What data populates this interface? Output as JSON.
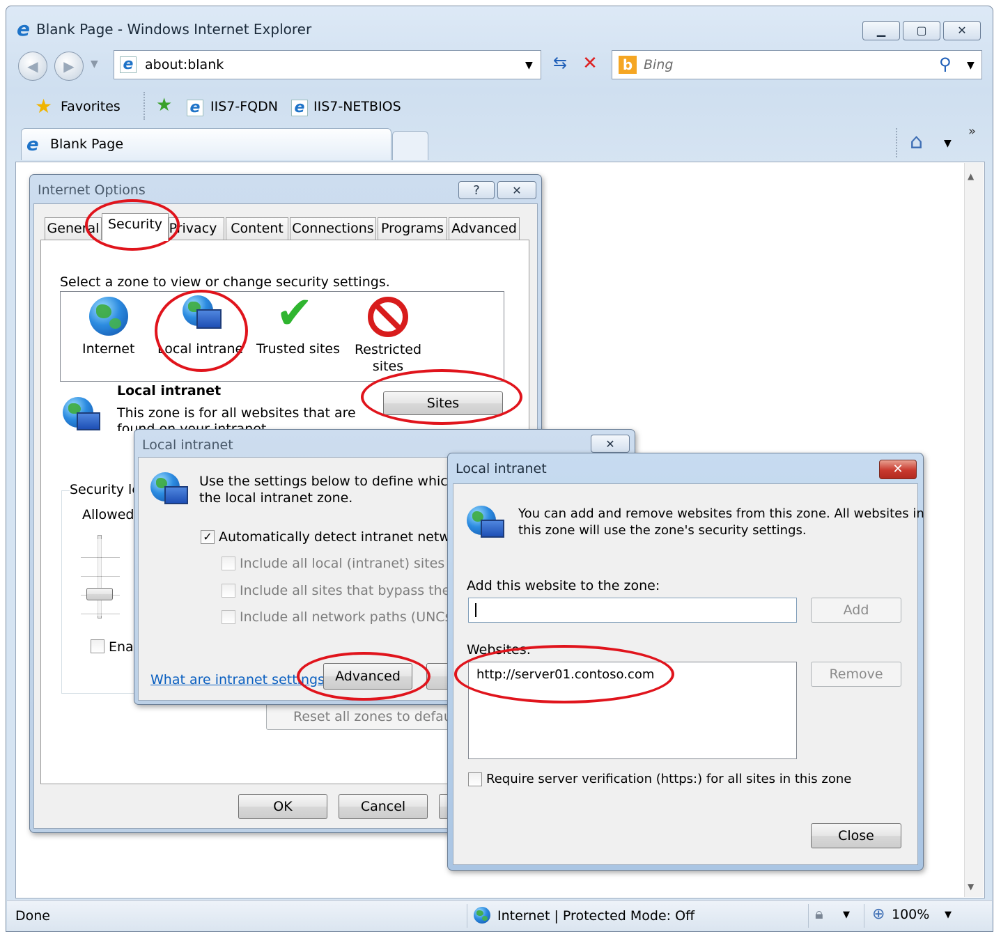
{
  "browser": {
    "title": "Blank Page - Windows Internet Explorer",
    "address": "about:blank",
    "search_placeholder": "Bing",
    "favorites_label": "Favorites",
    "favorites_items": [
      "IIS7-FQDN",
      "IIS7-NETBIOS"
    ],
    "tab_title": "Blank Page",
    "chevron": "»",
    "status_text": "Done",
    "zone_status": "Internet | Protected Mode: Off",
    "zoom": "100%"
  },
  "internet_options": {
    "title": "Internet Options",
    "help": "?",
    "tabs": [
      "General",
      "Security",
      "Privacy",
      "Content",
      "Connections",
      "Programs",
      "Advanced"
    ],
    "prompt": "Select a zone to view or change security settings.",
    "zones": [
      "Internet",
      "Local intranet",
      "Trusted sites",
      "Restricted sites"
    ],
    "zone_heading": "Local intranet",
    "zone_desc_1": "This zone is for all websites that are",
    "zone_desc_2": "found on your intranet.",
    "sites_button": "Sites",
    "security_level": "Security le",
    "allowed": "Allowed",
    "enable_protected": "Ena",
    "reset_all": "Reset all zones to default level",
    "ok": "OK",
    "cancel": "Cancel"
  },
  "intranet_dialog": {
    "title": "Local intranet",
    "desc_1": "Use the settings below to define which websites are included in",
    "desc_2": "the local intranet zone.",
    "auto_detect": "Automatically detect intranet network",
    "opt_local": "Include all local (intranet) sites not listed in other zones",
    "opt_bypass": "Include all sites that bypass the proxy server",
    "opt_unc": "Include all network paths (UNCs)",
    "help_link": "What are intranet settings?",
    "advanced": "Advanced"
  },
  "sites_dialog": {
    "title": "Local intranet",
    "close_x": "✕",
    "desc_1": "You can add and remove websites from this zone. All websites in",
    "desc_2": "this zone will use the zone's security settings.",
    "add_label": "Add this website to the zone:",
    "add_value": "",
    "add_button": "Add",
    "websites_label": "Websites:",
    "websites": [
      "http://server01.contoso.com"
    ],
    "remove_button": "Remove",
    "require_https": "Require server verification (https:) for all sites in this zone",
    "close_button": "Close"
  },
  "colors": {
    "annotation_red": "#e0141c",
    "sites_close_red": "#c8392e"
  }
}
